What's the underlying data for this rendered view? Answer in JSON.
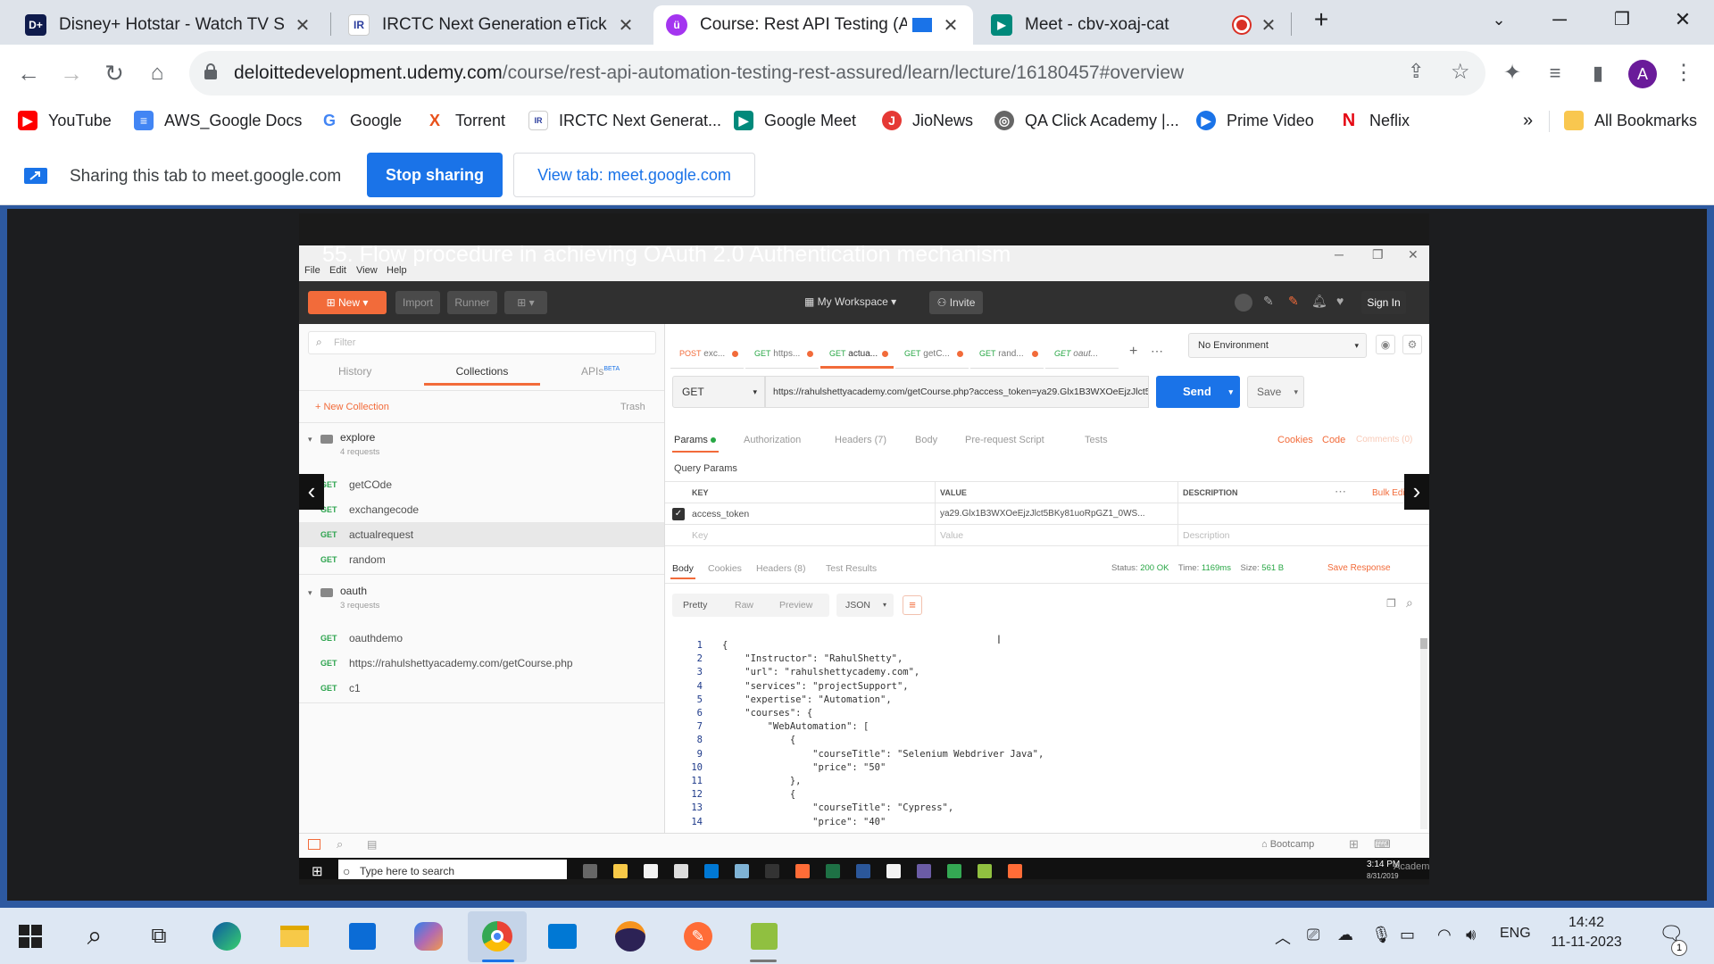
{
  "browser": {
    "tabs": [
      {
        "title": "Disney+ Hotstar - Watch TV Sho",
        "icon": "hotstar-icon"
      },
      {
        "title": "IRCTC Next Generation eTicketin",
        "icon": "irctc-icon"
      },
      {
        "title": "Course: Rest API Testing (Au",
        "icon": "udemy-icon",
        "active": true
      },
      {
        "title": "Meet - cbv-xoaj-cat",
        "icon": "meet-icon"
      }
    ],
    "url_domain": "deloittedevelopment.udemy.com",
    "url_path": "/course/rest-api-automation-testing-rest-assured/learn/lecture/16180457#overview",
    "profile_initial": "A",
    "bookmarks": [
      "YouTube",
      "AWS_Google Docs",
      "Google",
      "Torrent",
      "IRCTC Next Generat...",
      "Google Meet",
      "JioNews",
      "QA Click Academy |...",
      "Prime Video",
      "Neflix"
    ],
    "bookmarks_more": "»",
    "all_bookmarks": "All Bookmarks"
  },
  "sharing": {
    "text": "Sharing this tab to meet.google.com",
    "stop": "Stop sharing",
    "view": "View tab: meet.google.com"
  },
  "video": {
    "title": "55. Flow procedure in achieving OAuth 2.0 Authentication mechanism"
  },
  "postman": {
    "menu": [
      "File",
      "Edit",
      "View",
      "Help"
    ],
    "new": "New",
    "import": "Import",
    "runner": "Runner",
    "workspace": "My Workspace",
    "invite": "Invite",
    "sign_in": "Sign In",
    "filter": "Filter",
    "left_tabs": [
      "History",
      "Collections",
      "APIs"
    ],
    "beta": "BETA",
    "new_collection": "New Collection",
    "trash": "Trash",
    "collections": [
      {
        "name": "explore",
        "count": "4 requests",
        "requests": [
          {
            "method": "GET",
            "name": "getCOde"
          },
          {
            "method": "GET",
            "name": "exchangecode"
          },
          {
            "method": "GET",
            "name": "actualrequest"
          },
          {
            "method": "GET",
            "name": "random"
          }
        ]
      },
      {
        "name": "oauth",
        "count": "3 requests",
        "requests": [
          {
            "method": "GET",
            "name": "oauthdemo"
          },
          {
            "method": "GET",
            "name": "https://rahulshettyacademy.com/getCourse.php"
          },
          {
            "method": "GET",
            "name": "c1"
          }
        ]
      }
    ],
    "req_tabs": [
      {
        "method": "POST",
        "name": "exc..."
      },
      {
        "method": "GET",
        "name": "https..."
      },
      {
        "method": "GET",
        "name": "actua..."
      },
      {
        "method": "GET",
        "name": "getC..."
      },
      {
        "method": "GET",
        "name": "rand..."
      },
      {
        "method": "GET",
        "name": "oaut..."
      }
    ],
    "environment": "No Environment",
    "method": "GET",
    "request_url": "https://rahulshettyacademy.com/getCourse.php?access_token=ya29.Glx1B3WXOeEjzJlct5BKy81uo...",
    "send": "Send",
    "save": "Save",
    "sub_tabs": [
      "Params",
      "Authorization",
      "Headers (7)",
      "Body",
      "Pre-request Script",
      "Tests"
    ],
    "cookies": "Cookies",
    "code": "Code",
    "comments": "Comments (0)",
    "query_params": "Query Params",
    "cols": [
      "KEY",
      "VALUE",
      "DESCRIPTION"
    ],
    "bulk_edit": "Bulk Edit",
    "param_key": "access_token",
    "param_value": "ya29.Glx1B3WXOeEjzJlct5BKy81uoRpGZ1_0WS...",
    "key_ph": "Key",
    "value_ph": "Value",
    "desc_ph": "Description",
    "resp_tabs": [
      "Body",
      "Cookies",
      "Headers (8)",
      "Test Results"
    ],
    "status_label": "Status:",
    "status": "200 OK",
    "time_label": "Time:",
    "time": "1169ms",
    "size_label": "Size:",
    "size": "561 B",
    "save_response": "Save Response",
    "view_modes": [
      "Pretty",
      "Raw",
      "Preview"
    ],
    "format": "JSON",
    "code_lines": [
      "{",
      "    \"Instructor\": \"RahulShetty\",",
      "    \"url\": \"rahulshettycademy.com\",",
      "    \"services\": \"projectSupport\",",
      "    \"expertise\": \"Automation\",",
      "    \"courses\": {",
      "        \"WebAutomation\": [",
      "            {",
      "                \"courseTitle\": \"Selenium Webdriver Java\",",
      "                \"price\": \"50\"",
      "            },",
      "            {",
      "                \"courseTitle\": \"Cypress\",",
      "                \"price\": \"40\""
    ],
    "bootcamp": "Bootcamp",
    "inner_search": "Type here to search",
    "inner_time": "3:14 PM",
    "inner_date": "8/31/2019",
    "inner_watermark": "Academy"
  },
  "taskbar": {
    "lang": "ENG",
    "time": "14:42",
    "date": "11-11-2023",
    "notifications": "1"
  }
}
